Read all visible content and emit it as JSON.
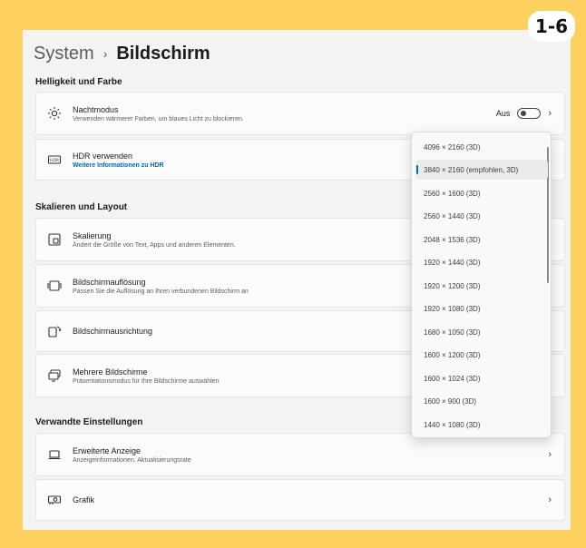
{
  "badge": "1-6",
  "breadcrumb": {
    "parent": "System",
    "separator": "›",
    "current": "Bildschirm"
  },
  "sections": {
    "brightness": "Helligkeit und Farbe",
    "scale": "Skalieren und Layout",
    "related": "Verwandte Einstellungen"
  },
  "items": {
    "night": {
      "title": "Nachtmodus",
      "subtitle": "Verwenden wärmerer Farben, um blaues Licht zu blockieren.",
      "toggle_label": "Aus",
      "icon": "brightness-icon"
    },
    "hdr": {
      "title": "HDR verwenden",
      "link": "Weitere Informationen zu HDR",
      "icon": "hdr-icon"
    },
    "scaling": {
      "title": "Skalierung",
      "subtitle": "Ändert die Größe von Text, Apps und anderen Elementen.",
      "icon": "scale-icon"
    },
    "resolution": {
      "title": "Bildschirmauflösung",
      "subtitle": "Passen Sie die Auflösung an Ihren verbundenen Bildschirm an",
      "icon": "resolution-icon"
    },
    "orientation": {
      "title": "Bildschirmausrichtung",
      "icon": "orientation-icon"
    },
    "multi": {
      "title": "Mehrere Bildschirme",
      "subtitle": "Präsentationsmodus für Ihre Bildschirme auswählen",
      "icon": "multi-monitor-icon"
    },
    "advanced": {
      "title": "Erweiterte Anzeige",
      "subtitle": "Anzeigeinformationen, Aktualisierungsrate",
      "icon": "laptop-icon"
    },
    "graphics": {
      "title": "Grafik",
      "icon": "graphics-card-icon"
    }
  },
  "chevron": "›",
  "dropdown": {
    "options": [
      "4096 × 2160 (3D)",
      "3840 × 2160 (empfohlen, 3D)",
      "2560 × 1600 (3D)",
      "2560 × 1440 (3D)",
      "2048 × 1536 (3D)",
      "1920 × 1440 (3D)",
      "1920 × 1200 (3D)",
      "1920 × 1080 (3D)",
      "1680 × 1050 (3D)",
      "1600 × 1200 (3D)",
      "1600 × 1024 (3D)",
      "1600 × 900 (3D)",
      "1440 × 1080 (3D)"
    ],
    "selected_index": 1
  },
  "colors": {
    "accent": "#0067c0",
    "frame": "#fcd15f"
  }
}
